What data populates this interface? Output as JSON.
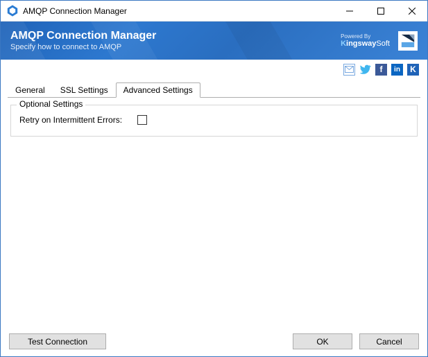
{
  "window": {
    "title": "AMQP Connection Manager"
  },
  "banner": {
    "title": "AMQP Connection Manager",
    "subtitle": "Specify how to connect to AMQP",
    "powered_by": "Powered By",
    "brand_name": "KingswaySoft"
  },
  "tabs": {
    "general": "General",
    "ssl": "SSL Settings",
    "advanced": "Advanced Settings",
    "active_index": 2
  },
  "advanced": {
    "group_title": "Optional Settings",
    "retry_label": "Retry on Intermittent Errors:",
    "retry_checked": false
  },
  "footer": {
    "test": "Test Connection",
    "ok": "OK",
    "cancel": "Cancel"
  }
}
